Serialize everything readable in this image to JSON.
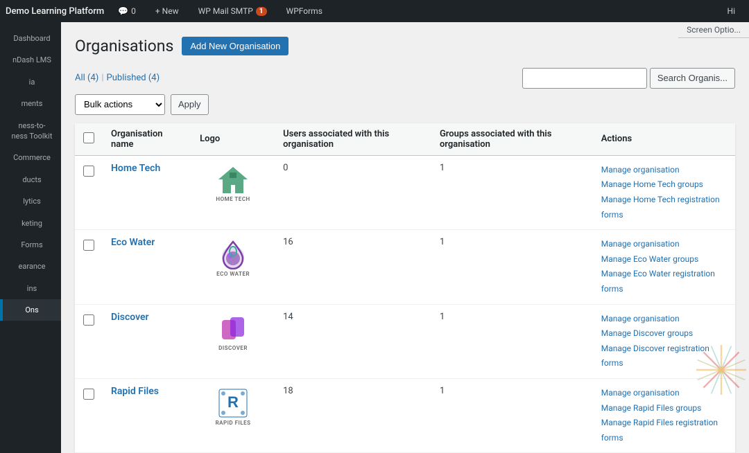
{
  "adminBar": {
    "siteName": "Demo Learning Platform",
    "items": [
      {
        "id": "comments",
        "icon": "💬",
        "count": "0",
        "badgeType": ""
      },
      {
        "id": "new",
        "label": "+ New"
      },
      {
        "id": "wpmail",
        "label": "WP Mail SMTP",
        "count": "1",
        "badgeType": "badge"
      },
      {
        "id": "wpforms",
        "label": "WPForms"
      }
    ],
    "rightText": "Hi"
  },
  "sidebar": {
    "items": [
      {
        "id": "dashboard",
        "label": "Dashboard"
      },
      {
        "id": "ndash-lms",
        "label": "nDash LMS"
      },
      {
        "id": "media",
        "label": "ia"
      },
      {
        "id": "ments",
        "label": "ments"
      },
      {
        "id": "ness-toolkit",
        "label": "ness-to-\nness Toolkit"
      },
      {
        "id": "woocommerce",
        "label": "oCommerce"
      },
      {
        "id": "ducts",
        "label": "ducts"
      },
      {
        "id": "lytics",
        "label": "lytics"
      },
      {
        "id": "keting",
        "label": "keting"
      },
      {
        "id": "forms",
        "label": "Forms"
      },
      {
        "id": "earance",
        "label": "earance"
      },
      {
        "id": "ins",
        "label": "ins"
      },
      {
        "id": "ons",
        "label": "Ons"
      }
    ]
  },
  "screenOptions": "Screen Optio...",
  "page": {
    "title": "Organisations",
    "addNewLabel": "Add New Organisation",
    "filters": {
      "allLabel": "All",
      "allCount": "(4)",
      "separator": "|",
      "publishedLabel": "Published",
      "publishedCount": "(4)"
    },
    "searchPlaceholder": "",
    "searchButtonLabel": "Search Organis...",
    "bulkActionsLabel": "Bulk actions",
    "applyLabel": "Apply"
  },
  "table": {
    "columns": [
      {
        "id": "cb",
        "label": ""
      },
      {
        "id": "name",
        "label": "Organisation name"
      },
      {
        "id": "logo",
        "label": "Logo"
      },
      {
        "id": "users",
        "label": "Users associated with this organisation"
      },
      {
        "id": "groups",
        "label": "Groups associated with this organisation"
      },
      {
        "id": "actions",
        "label": "Actions"
      }
    ],
    "rows": [
      {
        "id": "home-tech",
        "name": "Home Tech",
        "logoText": "HOME TECH",
        "logoColor": "#3d9a6e",
        "users": "0",
        "groups": "1",
        "actions": [
          {
            "id": "manage-org",
            "label": "Manage organisation"
          },
          {
            "id": "manage-groups",
            "label": "Manage Home Tech groups"
          },
          {
            "id": "manage-reg",
            "label": "Manage Home Tech registration forms"
          }
        ]
      },
      {
        "id": "eco-water",
        "name": "Eco Water",
        "logoText": "ECO WATER",
        "logoColor": "#7c3fa8",
        "users": "16",
        "groups": "1",
        "actions": [
          {
            "id": "manage-org",
            "label": "Manage organisation"
          },
          {
            "id": "manage-groups",
            "label": "Manage Eco Water groups"
          },
          {
            "id": "manage-reg",
            "label": "Manage Eco Water registration forms"
          }
        ]
      },
      {
        "id": "discover",
        "name": "Discover",
        "logoText": "DISCOVER",
        "logoColor": "#c44db8",
        "users": "14",
        "groups": "1",
        "actions": [
          {
            "id": "manage-org",
            "label": "Manage organisation"
          },
          {
            "id": "manage-groups",
            "label": "Manage Discover groups"
          },
          {
            "id": "manage-reg",
            "label": "Manage Discover registration forms"
          }
        ]
      },
      {
        "id": "rapid-files",
        "name": "Rapid Files",
        "logoText": "RAPID FILES",
        "logoColor": "#2271b1",
        "users": "18",
        "groups": "1",
        "actions": [
          {
            "id": "manage-org",
            "label": "Manage organisation"
          },
          {
            "id": "manage-groups",
            "label": "Manage Rapid Files groups"
          },
          {
            "id": "manage-reg",
            "label": "Manage Rapid Files registration forms"
          }
        ]
      }
    ]
  }
}
